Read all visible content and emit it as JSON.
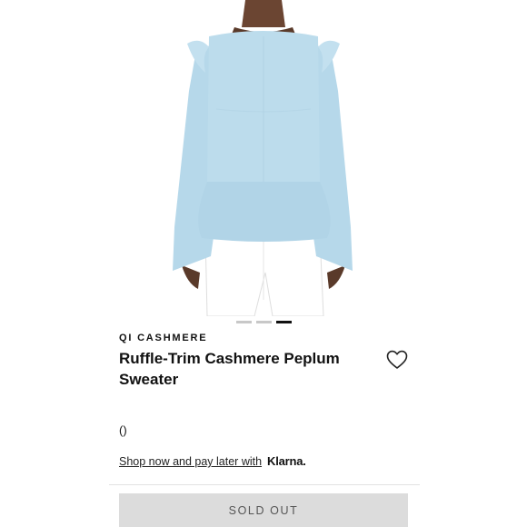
{
  "product": {
    "brand": "QI CASHMERE",
    "title": "Ruffle-Trim Cashmere Peplum Sweater",
    "price": "()"
  },
  "carousel": {
    "total_images": 3,
    "active_index": 2
  },
  "financing": {
    "link_text": "Shop now and pay later with",
    "provider": "Klarna."
  },
  "actions": {
    "sold_out_label": "SOLD OUT",
    "wishlist_icon": "heart-outline-icon"
  },
  "colors": {
    "sweater": "#bcdcec",
    "button_bg": "#dcdcdc"
  }
}
